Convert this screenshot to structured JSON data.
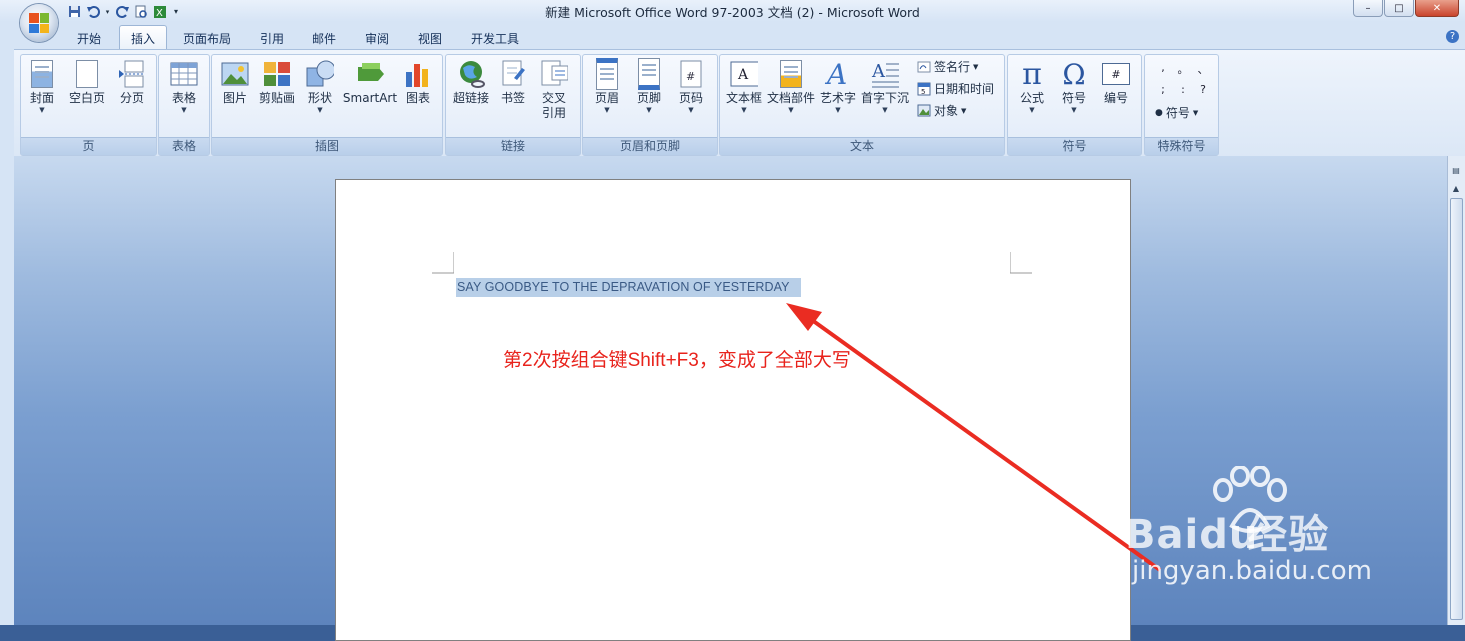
{
  "window": {
    "title": "新建 Microsoft Office Word 97-2003 文档 (2) - Microsoft Word",
    "controls": [
      "–",
      "□",
      "✕"
    ]
  },
  "quick_access": [
    "save-icon",
    "undo-icon",
    "redo-icon",
    "print-preview-icon",
    "excel-icon",
    "customize-icon"
  ],
  "tabs": [
    {
      "label": "开始",
      "active": false
    },
    {
      "label": "插入",
      "active": true
    },
    {
      "label": "页面布局",
      "active": false
    },
    {
      "label": "引用",
      "active": false
    },
    {
      "label": "邮件",
      "active": false
    },
    {
      "label": "审阅",
      "active": false
    },
    {
      "label": "视图",
      "active": false
    },
    {
      "label": "开发工具",
      "active": false
    }
  ],
  "help_label": "?",
  "ribbon": {
    "groups": {
      "pages": {
        "label": "页",
        "buttons": [
          "封面",
          "空白页",
          "分页"
        ]
      },
      "tables": {
        "label": "表格",
        "buttons": [
          "表格"
        ]
      },
      "illustrations": {
        "label": "插图",
        "buttons": [
          "图片",
          "剪贴画",
          "形状",
          "SmartArt",
          "图表"
        ]
      },
      "links": {
        "label": "链接",
        "buttons": [
          "超链接",
          "书签",
          "交叉",
          "引用"
        ]
      },
      "header_footer": {
        "label": "页眉和页脚",
        "buttons": [
          "页眉",
          "页脚",
          "页码"
        ]
      },
      "text": {
        "label": "文本",
        "buttons": [
          "文本框",
          "文档部件",
          "艺术字",
          "首字下沉"
        ],
        "small": [
          "签名行",
          "日期和时间",
          "对象"
        ]
      },
      "symbols": {
        "label": "符号",
        "buttons": [
          "公式",
          "符号",
          "编号"
        ],
        "glyphs": [
          "π",
          "Ω",
          "#"
        ]
      },
      "special": {
        "label": "特殊符号",
        "marks": [
          ",",
          "。",
          "、",
          ";",
          ":",
          "?"
        ],
        "button": "符号"
      }
    }
  },
  "document": {
    "selected_text": "SAY GOODBYE TO THE DEPRAVATION OF YESTERDAY",
    "annotation": "第2次按组合键Shift+F3，变成了全部大写"
  },
  "watermark": {
    "brand": "Bai",
    "brand_cn": "经验",
    "url": "jingyan.baidu.com"
  },
  "colors": {
    "annotation": "#e8231c",
    "selection": "#b8cfe8",
    "ribbon": "#dbe7f6",
    "workspace": "#7b9fd0"
  }
}
